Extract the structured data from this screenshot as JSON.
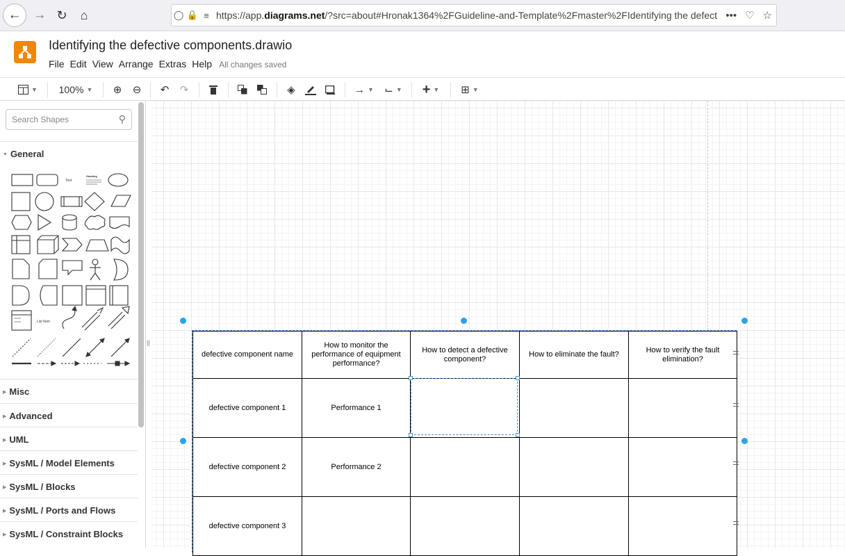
{
  "browser": {
    "url_prefix": "https://app.",
    "url_domain": "diagrams.net",
    "url_rest": "/?src=about#Hronak1364%2FGuideline-and-Template%2Fmaster%2FIdentifying the defect",
    "overflow_glyph": "•••"
  },
  "app": {
    "title": "Identifying the defective components.drawio",
    "menu": [
      "File",
      "Edit",
      "View",
      "Arrange",
      "Extras",
      "Help"
    ],
    "status": "All changes saved",
    "accent": "#f08705"
  },
  "toolbar": {
    "zoom": "100%"
  },
  "sidebar": {
    "search_placeholder": "Search Shapes",
    "general_label": "General",
    "shape_text_label": "Text",
    "shape_heading_label": "Heading",
    "shape_list_label": "List Item",
    "sections": [
      "Misc",
      "Advanced",
      "UML",
      "SysML / Model Elements",
      "SysML / Blocks",
      "SysML / Ports and Flows",
      "SysML / Constraint Blocks"
    ]
  },
  "table": {
    "headers": [
      "defective component name",
      "How to monitor the performance of equipment performance?",
      "How to detect a defective component?",
      "How to eliminate the fault?",
      "How to verify the fault elimination?"
    ],
    "rows": [
      [
        "defective component 1",
        "Performance 1",
        "",
        "",
        ""
      ],
      [
        "defective component 2",
        "Performance 2",
        "",
        "",
        ""
      ],
      [
        "defective component 3",
        "",
        "",
        "",
        ""
      ]
    ]
  },
  "colors": {
    "selection": "#3d8ed8",
    "handle": "#29a3f0"
  }
}
